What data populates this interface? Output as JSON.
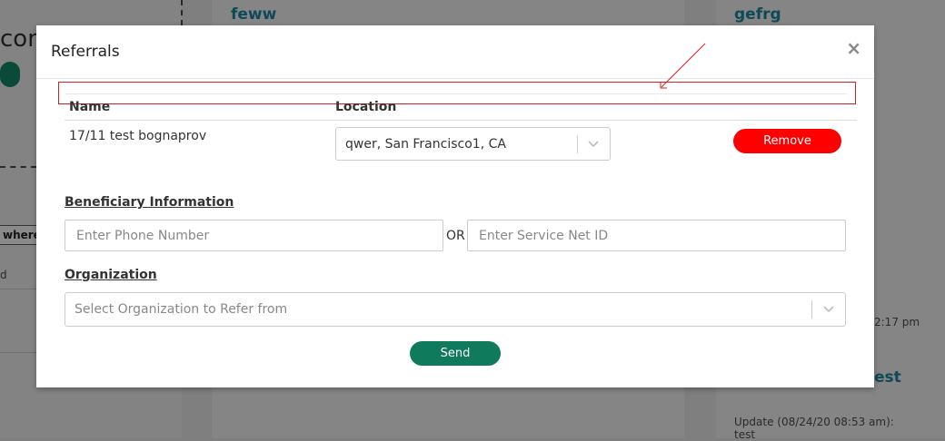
{
  "background": {
    "left_card": {
      "heading_fragment": "con",
      "button_fragment": "where",
      "text_fragment": "d"
    },
    "middle_card": {
      "title": "feww"
    },
    "right_card": {
      "title": "gefrg",
      "time_fragment": "2:17 pm",
      "title2_fragment": "est",
      "update_label": "Update (08/24/20 08:53 am):",
      "update_text": "test"
    }
  },
  "modal": {
    "title": "Referrals",
    "close_glyph": "×",
    "table": {
      "columns": [
        "Name",
        "Location"
      ],
      "rows": [
        {
          "name": "17/11 test bognaprov",
          "location": "qwer, San Francisco1, CA",
          "remove_label": "Remove"
        }
      ]
    },
    "beneficiary": {
      "label": "Beneficiary Information",
      "phone_placeholder": "Enter Phone Number",
      "or_label": "OR",
      "service_net_placeholder": "Enter Service Net ID"
    },
    "organization": {
      "label": "Organization",
      "placeholder": "Select Organization to Refer from"
    },
    "send_label": "Send"
  },
  "colors": {
    "remove": "#ff0000",
    "send": "#0f7a5c",
    "annotation": "#d21f1f"
  }
}
